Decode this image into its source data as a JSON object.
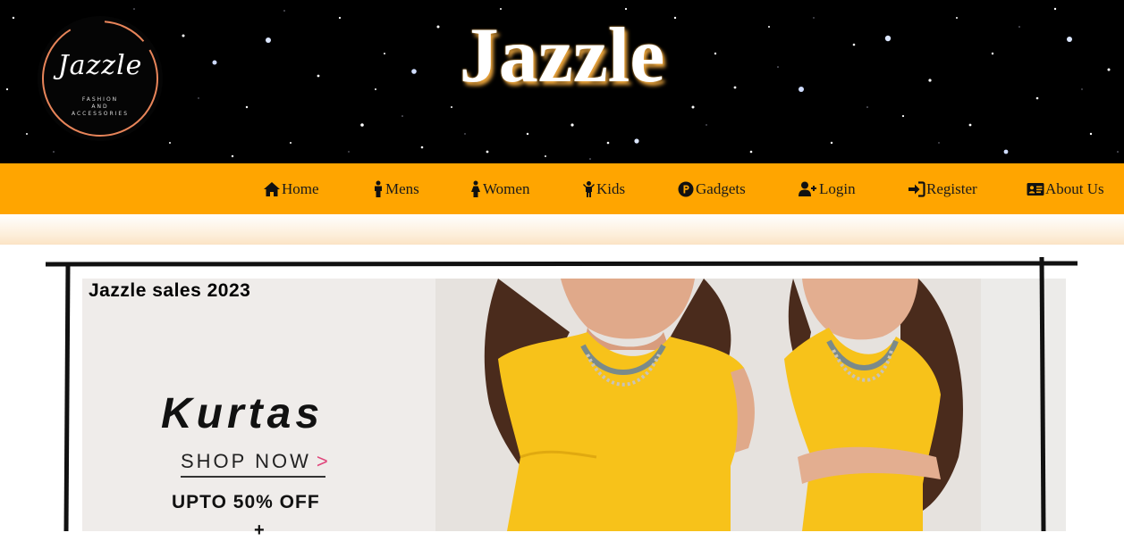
{
  "header": {
    "site_title": "Jazzle",
    "logo": {
      "script_text": "Jazzle",
      "tagline_lines": [
        "FASHION",
        "AND",
        "ACCESSORIES"
      ]
    }
  },
  "nav": {
    "items": [
      {
        "label": "Home",
        "icon": "home-icon"
      },
      {
        "label": "Mens",
        "icon": "male-icon"
      },
      {
        "label": "Women",
        "icon": "female-icon"
      },
      {
        "label": "Kids",
        "icon": "child-icon"
      },
      {
        "label": "Gadgets",
        "icon": "product-hunt-icon"
      },
      {
        "label": "Login",
        "icon": "user-plus-icon"
      },
      {
        "label": "Register",
        "icon": "sign-in-icon"
      },
      {
        "label": "About Us",
        "icon": "address-card-icon"
      }
    ]
  },
  "banner": {
    "sale_title": "Jazzle sales 2023",
    "product": "Kurtas",
    "cta": "SHOP NOW",
    "cta_arrow": ">",
    "offer": "UPTO 50% OFF",
    "plus": "+"
  },
  "colors": {
    "nav_bg": "#ffa500",
    "header_bg": "#000000",
    "title_glow": "#e8a33c",
    "logo_ring": "#e8855a",
    "dress_yellow": "#f7c21a"
  }
}
